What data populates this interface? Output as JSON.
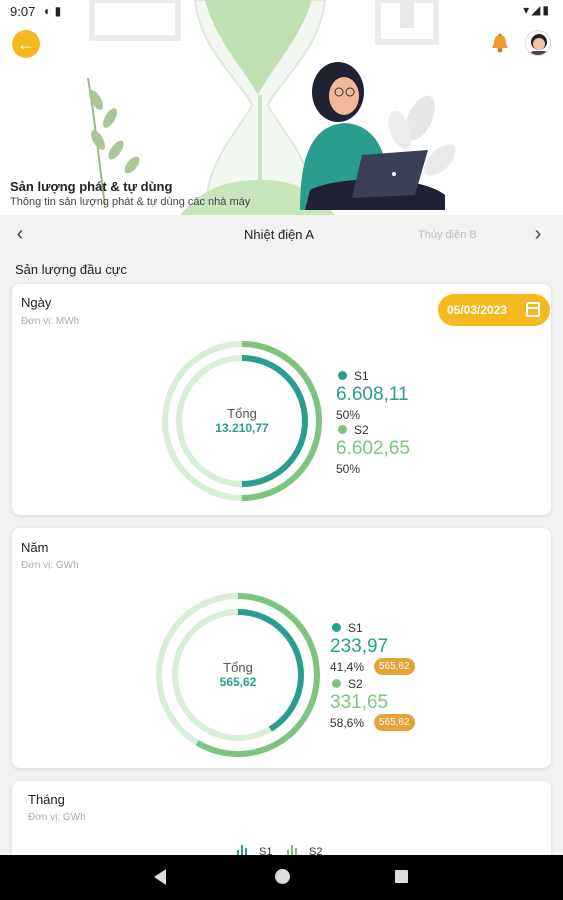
{
  "status_bar": {
    "time": "9:07",
    "left_icons": "◐ ▮",
    "right_icons": "▾◢▮"
  },
  "header": {
    "title": "Sản lượng phát & tự dùng",
    "subtitle": "Thông tin sản lượng phát & tự dùng các nhà máy"
  },
  "plants": {
    "active": "Nhiệt điện A",
    "next": "Thủy điện B"
  },
  "section_title": "Sản lượng đầu cực",
  "day_card": {
    "title": "Ngày",
    "unit": "Đơn vị: MWh",
    "date": "05/03/2023",
    "total_label": "Tổng",
    "total_value": "13.210,77",
    "s1": {
      "name": "S1",
      "value": "6.608,11",
      "percent": "50%",
      "share": 0.5
    },
    "s2": {
      "name": "S2",
      "value": "6.602,65",
      "percent": "50%",
      "share": 0.5
    }
  },
  "year_card": {
    "title": "Năm",
    "unit": "Đơn vị: GWh",
    "total_label": "Tổng",
    "total_value": "565,62",
    "s1": {
      "name": "S1",
      "value": "233,97",
      "percent": "41,4%",
      "badge": "565,62",
      "share": 0.414
    },
    "s2": {
      "name": "S2",
      "value": "331,65",
      "percent": "58,6%",
      "badge": "565,62",
      "share": 0.586
    }
  },
  "month_card": {
    "title": "Tháng",
    "unit": "Đơn vị: GWh",
    "legend": [
      {
        "name": "S1"
      },
      {
        "name": "S2"
      }
    ]
  },
  "colors": {
    "accent": "#f5b920",
    "s1": "#2a9d8f",
    "s2": "#7cc47f",
    "s2_light": "#cfe8cf",
    "badge": "#e8a23a"
  },
  "icons": {
    "back": "arrow-left-icon",
    "bell": "bell-icon",
    "calendar": "calendar-icon",
    "prev": "chevron-left-icon",
    "next": "chevron-right-icon"
  }
}
